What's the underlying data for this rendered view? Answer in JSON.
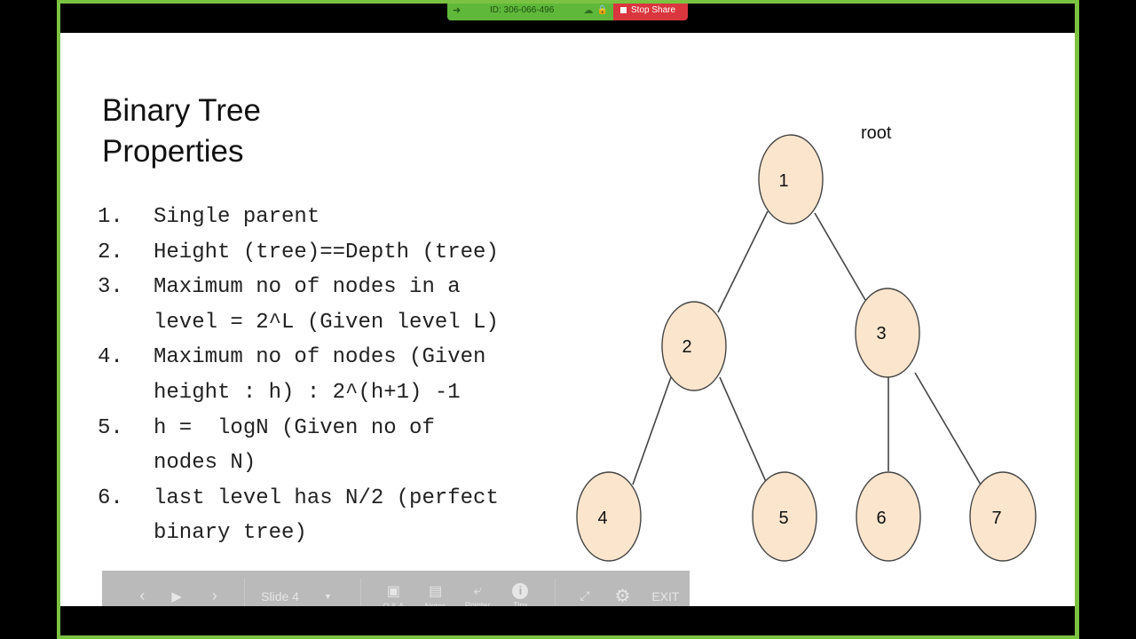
{
  "share_bar": {
    "meeting_id": "ID: 306-066-496",
    "stop_share_label": "Stop Share",
    "colors": {
      "green": "#5fb83a",
      "red": "#d9363e",
      "frame": "#7cc242"
    }
  },
  "slide": {
    "title_line1": "Binary Tree",
    "title_line2": "Properties",
    "items": [
      {
        "num": "1.",
        "lines": [
          "Single parent"
        ]
      },
      {
        "num": "2.",
        "lines": [
          "Height (tree)==Depth (tree)"
        ]
      },
      {
        "num": "3.",
        "lines": [
          "Maximum no of nodes in a",
          "level = 2^L (Given level L)"
        ]
      },
      {
        "num": "4.",
        "lines": [
          "Maximum no of nodes (Given",
          "height : h) : 2^(h+1) -1"
        ]
      },
      {
        "num": "5.",
        "lines": [
          "h =  logN (Given no of",
          "nodes N)"
        ]
      },
      {
        "num": "6.",
        "lines": [
          "last level has N/2 (perfect",
          "binary tree)"
        ]
      }
    ],
    "tree": {
      "root_label": "root",
      "node_fill": "#fbe5cd",
      "nodes": [
        "1",
        "2",
        "3",
        "4",
        "5",
        "6",
        "7"
      ],
      "edges": [
        [
          "1",
          "2"
        ],
        [
          "1",
          "3"
        ],
        [
          "2",
          "4"
        ],
        [
          "2",
          "5"
        ],
        [
          "3",
          "6"
        ],
        [
          "3",
          "7"
        ]
      ]
    }
  },
  "toolbar": {
    "slide_label": "Slide 4",
    "qa_label": "Q & A",
    "notes_label": "Notes",
    "pointer_label": "Pointer",
    "tips_label": "Tips",
    "exit_label": "EXIT"
  }
}
